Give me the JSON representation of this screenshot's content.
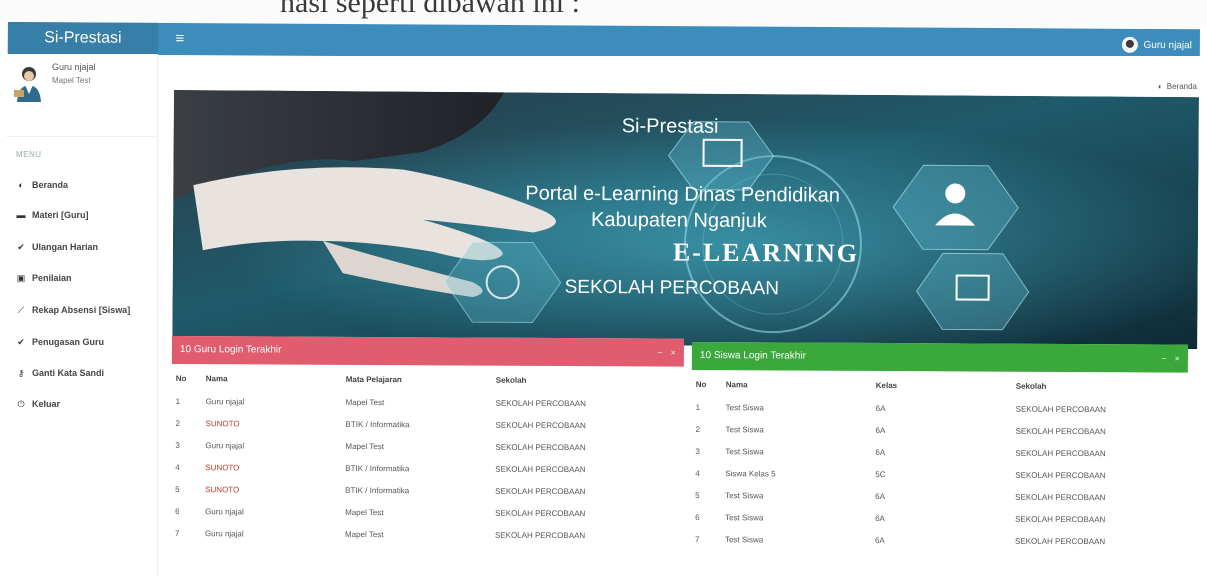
{
  "paper_text": "nasi seperti dibawah ini :",
  "header": {
    "logo": "Si-Prestasi",
    "toggle_icon": "bars-icon",
    "user_name": "Guru njajal"
  },
  "sidebar": {
    "user_name": "Guru njajal",
    "user_subject": "Mapel Test",
    "menu_header": "MENU",
    "items": [
      {
        "icon": "dashboard-icon",
        "glyph": "◐",
        "label": "Beranda"
      },
      {
        "icon": "folder-icon",
        "glyph": "▬",
        "label": "Materi [Guru]"
      },
      {
        "icon": "check-icon",
        "glyph": "✔",
        "label": "Ulangan Harian"
      },
      {
        "icon": "score-icon",
        "glyph": "▣",
        "label": "Penilaian"
      },
      {
        "icon": "line-chart-icon",
        "glyph": "⟋",
        "label": "Rekap Absensi [Siswa]"
      },
      {
        "icon": "check-icon",
        "glyph": "✔",
        "label": "Penugasan Guru"
      },
      {
        "icon": "key-icon",
        "glyph": "⚷",
        "label": "Ganti Kata Sandi"
      },
      {
        "icon": "power-icon",
        "glyph": "⏻",
        "label": "Keluar"
      }
    ]
  },
  "breadcrumb": {
    "icon": "dashboard-icon",
    "label": "Beranda"
  },
  "banner": {
    "title": "Si-Prestasi",
    "line1": "Portal e-Learning Dinas Pendidikan",
    "line2": "Kabupaten Nganjuk",
    "elearning": "E-LEARNING",
    "school": "SEKOLAH PERCOBAAN"
  },
  "guru_box": {
    "title": "10 Guru Login Terakhir",
    "color": "#e05d6f",
    "columns": [
      "No",
      "Nama",
      "Mata Pelajaran",
      "Sekolah"
    ],
    "rows": [
      [
        "1",
        "Guru njajal",
        "Mapel Test",
        "SEKOLAH PERCOBAAN"
      ],
      [
        "2",
        "SUNOTO",
        "BTIK / Informatika",
        "SEKOLAH PERCOBAAN"
      ],
      [
        "3",
        "Guru njajal",
        "Mapel Test",
        "SEKOLAH PERCOBAAN"
      ],
      [
        "4",
        "SUNOTO",
        "BTIK / Informatika",
        "SEKOLAH PERCOBAAN"
      ],
      [
        "5",
        "SUNOTO",
        "BTIK / Informatika",
        "SEKOLAH PERCOBAAN"
      ],
      [
        "6",
        "Guru njajal",
        "Mapel Test",
        "SEKOLAH PERCOBAAN"
      ],
      [
        "7",
        "Guru njajal",
        "Mapel Test",
        "SEKOLAH PERCOBAAN"
      ]
    ]
  },
  "siswa_box": {
    "title": "10 Siswa Login Terakhir",
    "color": "#3aa83a",
    "columns": [
      "No",
      "Nama",
      "Kelas",
      "Sekolah"
    ],
    "rows": [
      [
        "1",
        "Test Siswa",
        "6A",
        "SEKOLAH PERCOBAAN"
      ],
      [
        "2",
        "Test Siswa",
        "6A",
        "SEKOLAH PERCOBAAN"
      ],
      [
        "3",
        "Test Siswa",
        "6A",
        "SEKOLAH PERCOBAAN"
      ],
      [
        "4",
        "Siswa Kelas 5",
        "5C",
        "SEKOLAH PERCOBAAN"
      ],
      [
        "5",
        "Test Siswa",
        "6A",
        "SEKOLAH PERCOBAAN"
      ],
      [
        "6",
        "Test Siswa",
        "6A",
        "SEKOLAH PERCOBAAN"
      ],
      [
        "7",
        "Test Siswa",
        "6A",
        "SEKOLAH PERCOBAAN"
      ]
    ]
  },
  "box_tools": {
    "collapse": "−",
    "close": "×"
  }
}
